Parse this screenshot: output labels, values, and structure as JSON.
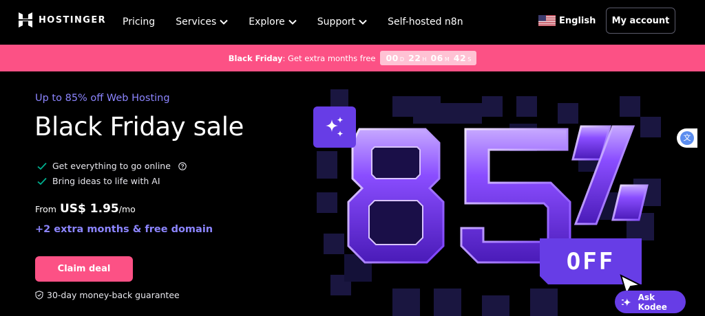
{
  "header": {
    "brand": "HOSTINGER",
    "nav": [
      {
        "label": "Pricing",
        "dropdown": false
      },
      {
        "label": "Services",
        "dropdown": true
      },
      {
        "label": "Explore",
        "dropdown": true
      },
      {
        "label": "Support",
        "dropdown": true
      },
      {
        "label": "Self-hosted n8n",
        "dropdown": false
      }
    ],
    "language": "English",
    "language_flag_icon": "us-flag-icon",
    "account_label": "My account"
  },
  "promo": {
    "bold": "Black Friday",
    "text": ": Get extra months free",
    "countdown": [
      {
        "value": "00",
        "unit": "D"
      },
      {
        "value": "22",
        "unit": "H"
      },
      {
        "value": "06",
        "unit": "M"
      },
      {
        "value": "42",
        "unit": "S"
      }
    ],
    "color": "#fc5185"
  },
  "hero": {
    "label": "Up to 85% off Web Hosting",
    "title": "Black Friday sale",
    "features": [
      {
        "text": "Get everything to go online",
        "icon": "check-icon",
        "info_icon": "question-circle-icon"
      },
      {
        "text": "Bring ideas to life with AI",
        "icon": "check-icon"
      }
    ],
    "price_prefix": "From",
    "price_amount": "US$ 1.95",
    "price_suffix": "/mo",
    "bonus": "+2 extra months & free domain",
    "cta": "Claim deal",
    "guarantee": "30-day money-back guarantee",
    "guarantee_icon": "shield-check-icon",
    "art": {
      "discount": "85%",
      "off_label": "OFF",
      "sparkle_icon": "sparkles-icon",
      "cursor_icon": "arrow-cursor-icon"
    }
  },
  "floating": {
    "translate_icon": "translate-icon",
    "ask_kodee": "Ask Kodee",
    "kodee_icon": "kodee-sparkle-icon"
  },
  "colors": {
    "accent": "#673de6",
    "accent_light": "#8c85ff",
    "pink": "#fc5185",
    "check": "#00b090",
    "background": "#000000"
  }
}
